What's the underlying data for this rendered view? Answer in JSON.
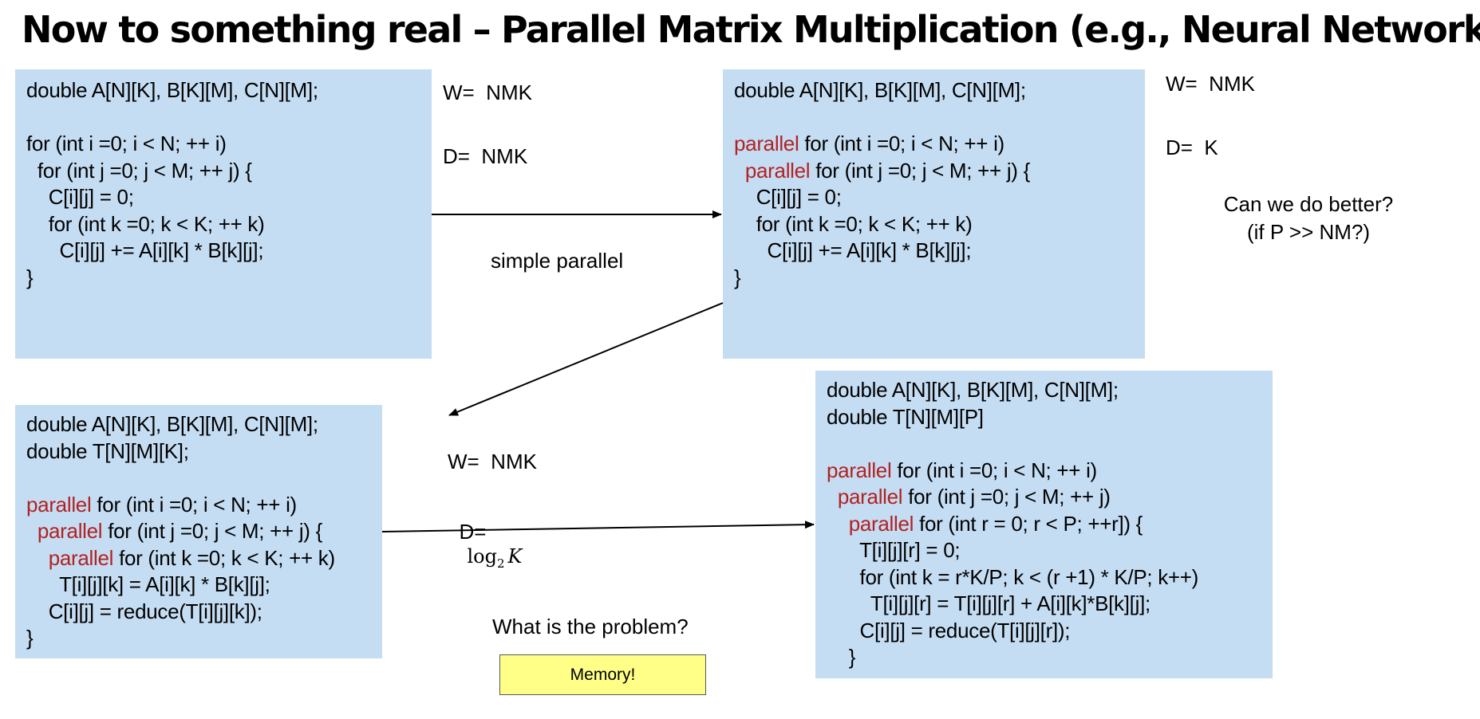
{
  "slide": {
    "title": "Now to something real – Parallel Matrix Multiplication (e.g., Neural Networks)"
  },
  "box1": {
    "lines": [
      {
        "indent": "",
        "kw": "",
        "text": "double A[N][K], B[K][M], C[N][M];"
      },
      {
        "indent": "",
        "kw": "",
        "text": ""
      },
      {
        "indent": "",
        "kw": "",
        "text": "for (int i =0; i < N; ++ i)"
      },
      {
        "indent": "  ",
        "kw": "",
        "text": "for (int j =0; j < M; ++ j) {"
      },
      {
        "indent": "    ",
        "kw": "",
        "text": "C[i][j] = 0;"
      },
      {
        "indent": "    ",
        "kw": "",
        "text": "for (int k =0; k < K; ++ k)"
      },
      {
        "indent": "      ",
        "kw": "",
        "text": "C[i][j] += A[i][k] * B[k][j];"
      },
      {
        "indent": "",
        "kw": "",
        "text": "}"
      }
    ]
  },
  "box2": {
    "lines": [
      {
        "indent": "",
        "kw": "",
        "text": "double A[N][K], B[K][M], C[N][M];"
      },
      {
        "indent": "",
        "kw": "",
        "text": ""
      },
      {
        "indent": "",
        "kw": "parallel",
        "text": " for (int i =0; i < N; ++ i)"
      },
      {
        "indent": "  ",
        "kw": "parallel",
        "text": " for (int j =0; j < M; ++ j) {"
      },
      {
        "indent": "    ",
        "kw": "",
        "text": "C[i][j] = 0;"
      },
      {
        "indent": "    ",
        "kw": "",
        "text": "for (int k =0; k < K; ++ k)"
      },
      {
        "indent": "      ",
        "kw": "",
        "text": "C[i][j] += A[i][k] * B[k][j];"
      },
      {
        "indent": "",
        "kw": "",
        "text": "}"
      }
    ]
  },
  "box3": {
    "lines": [
      {
        "indent": "",
        "kw": "",
        "text": "double A[N][K], B[K][M], C[N][M];"
      },
      {
        "indent": "",
        "kw": "",
        "text": "double T[N][M][K];"
      },
      {
        "indent": "",
        "kw": "",
        "text": ""
      },
      {
        "indent": "",
        "kw": "parallel",
        "text": " for (int i =0; i < N; ++ i)"
      },
      {
        "indent": "  ",
        "kw": "parallel",
        "text": " for (int j =0; j < M; ++ j) {"
      },
      {
        "indent": "    ",
        "kw": "parallel",
        "text": " for (int k =0; k < K; ++ k)"
      },
      {
        "indent": "      ",
        "kw": "",
        "text": "T[i][j][k] = A[i][k] * B[k][j];"
      },
      {
        "indent": "    ",
        "kw": "",
        "text": "C[i][j] = reduce(T[i][j][k]);"
      },
      {
        "indent": "",
        "kw": "",
        "text": "}"
      }
    ]
  },
  "box4": {
    "lines": [
      {
        "indent": "",
        "kw": "",
        "text": "double A[N][K], B[K][M], C[N][M];"
      },
      {
        "indent": "",
        "kw": "",
        "text": "double T[N][M][P]"
      },
      {
        "indent": "",
        "kw": "",
        "text": ""
      },
      {
        "indent": "",
        "kw": "parallel",
        "text": " for (int i =0; i < N; ++ i)"
      },
      {
        "indent": "  ",
        "kw": "parallel",
        "text": " for (int j =0; j < M; ++ j)"
      },
      {
        "indent": "    ",
        "kw": "parallel",
        "text": " for (int r = 0; r < P; ++r]) {"
      },
      {
        "indent": "      ",
        "kw": "",
        "text": "T[i][j][r] = 0;"
      },
      {
        "indent": "      ",
        "kw": "",
        "text": "for (int k = r*K/P; k < (r +1) * K/P; k++)"
      },
      {
        "indent": "        ",
        "kw": "",
        "text": "T[i][j][r] = T[i][j][r] + A[i][k]*B[k][j];"
      },
      {
        "indent": "      ",
        "kw": "",
        "text": "C[i][j] = reduce(T[i][j][r]);"
      },
      {
        "indent": "    ",
        "kw": "",
        "text": "}"
      }
    ]
  },
  "notes": {
    "w1": "W=  NMK",
    "d1": "D=  NMK",
    "simple_parallel": "simple parallel",
    "w2": "W=  NMK",
    "d2": "D=  K",
    "better_q": "Can we do better?",
    "better_sub": "(if P >> NM?)",
    "w3": "W=  NMK",
    "d3_label": "D=",
    "d3_log": "log",
    "d3_base": "2",
    "d3_var": "K",
    "problem": "What is the problem?",
    "memory": "Memory!"
  },
  "colors": {
    "box_bg": "#c5ddf3",
    "keyword": "#b22222",
    "memory_bg": "#ffff88"
  }
}
